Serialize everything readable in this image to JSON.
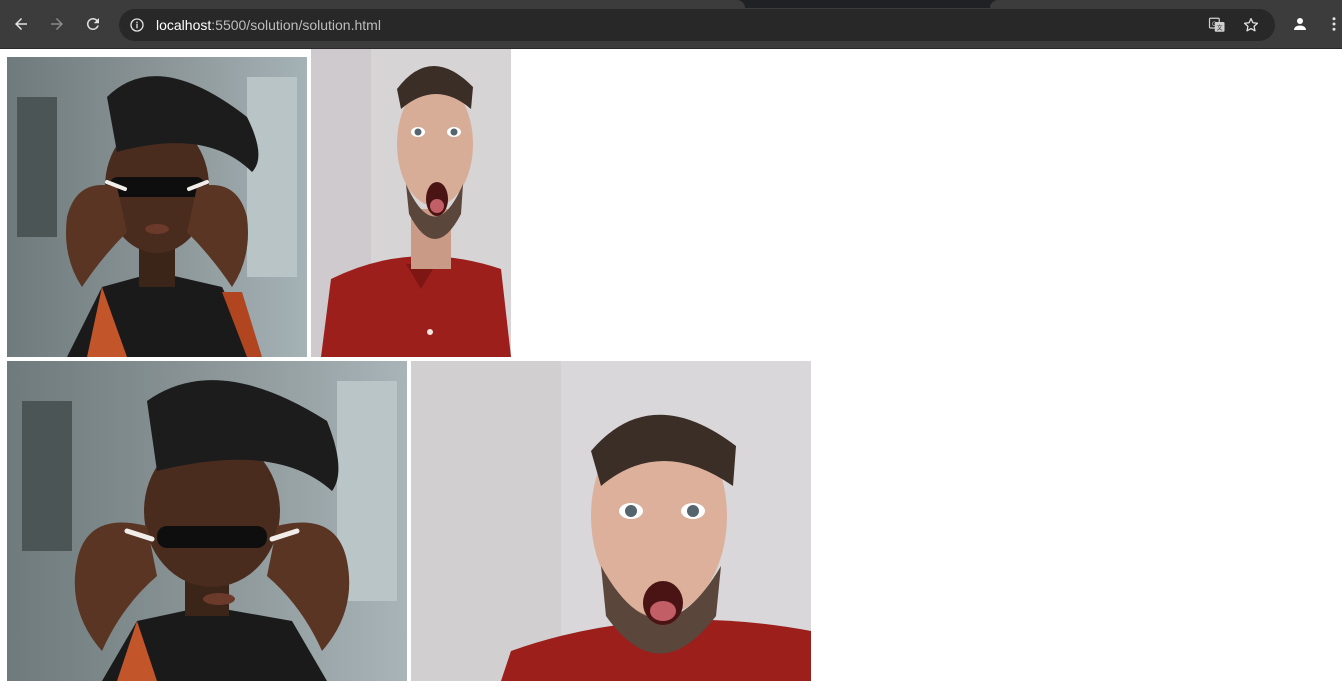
{
  "browser": {
    "url_host": "localhost",
    "url_path": ":5500/solution/solution.html",
    "icons": [
      "back-arrow-icon",
      "forward-arrow-icon",
      "reload-icon",
      "site-info-icon",
      "translate-icon",
      "bookmark-star-icon",
      "profile-icon",
      "menu-icon"
    ]
  },
  "page": {
    "images": [
      {
        "subject": "woman-beret-sunglasses",
        "crop": "square"
      },
      {
        "subject": "surprised-man-red-shirt",
        "crop": "tall"
      },
      {
        "subject": "woman-beret-sunglasses",
        "crop": "wide"
      },
      {
        "subject": "surprised-man-red-shirt",
        "crop": "wide"
      }
    ]
  },
  "colors": {
    "chrome_bg": "#3c3c3c",
    "omnibox_bg": "#282828",
    "page_bg": "#ffffff"
  }
}
